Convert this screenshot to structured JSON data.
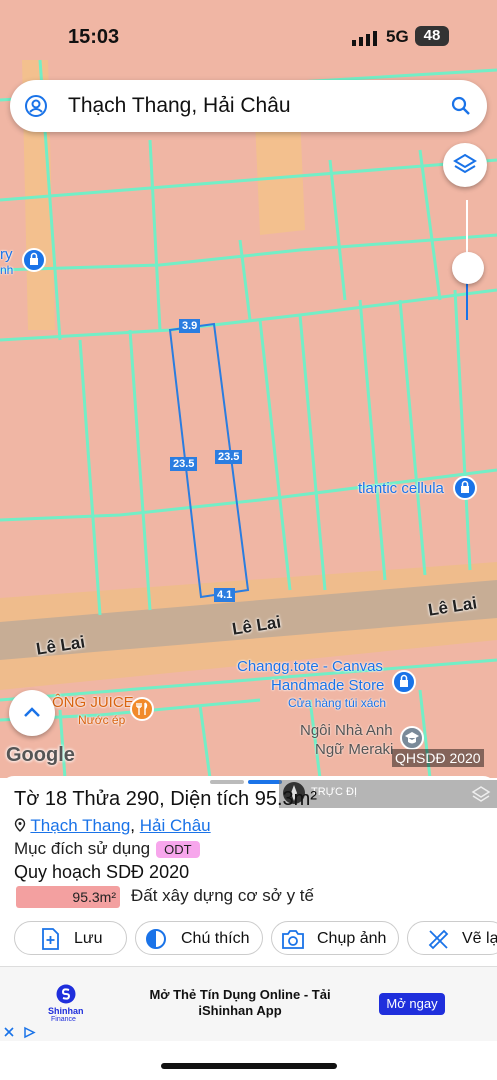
{
  "status_bar": {
    "time": "15:03",
    "network": "5G",
    "battery": "48"
  },
  "search": {
    "query": "Thạch Thang, Hải Châu"
  },
  "map": {
    "road_labels": [
      "Lê Lai",
      "Lê Lai",
      "Lê Lai"
    ],
    "dimensions": {
      "top": "3.9",
      "left": "23.5",
      "right": "23.5",
      "bottom": "4.1"
    },
    "pois": {
      "left_partial_1": "ry",
      "left_partial_2": "nh",
      "atlantic": "tlantic cellula",
      "changg_line1": "Changg.tote - Canvas",
      "changg_line2": "Handmade Store",
      "changg_sub": "Cửa hàng túi xách",
      "juice": "ÔNG JUICE",
      "juice_sub": "Nước ép",
      "ngoi_line1": "Ngôi Nhà Anh",
      "ngoi_line2": "Ngữ Meraki"
    },
    "attribution": "Google",
    "layer_label": "QHSDĐ 2020",
    "toggle_label": "TRỰC ĐỊ"
  },
  "panel": {
    "title": "Tờ 18 Thửa 290, Diện tích 95.3m²",
    "ward": "Thạch Thang",
    "separator": ",",
    "district": "Hải Châu",
    "land_use_label": "Mục đích sử dụng",
    "land_use_code": "ODT",
    "plan_label": "Quy hoạch SDĐ 2020",
    "plan_area": "95.3m²",
    "plan_purpose": "Đất xây dựng cơ sở y tế",
    "actions": [
      "Lưu",
      "Chú thích",
      "Chụp ảnh",
      "Vẽ lạ"
    ]
  },
  "ad": {
    "brand": "Shinhan",
    "brand_sub": "Finance",
    "headline": "Mở Thẻ Tín Dụng Online - Tải iShinhan App",
    "cta": "Mở ngay"
  },
  "colors": {
    "accent": "#1a73e8",
    "parcel_bg": "#f0b6a4",
    "parcel_lines": "#73eec6",
    "road": "#c7ad95"
  }
}
